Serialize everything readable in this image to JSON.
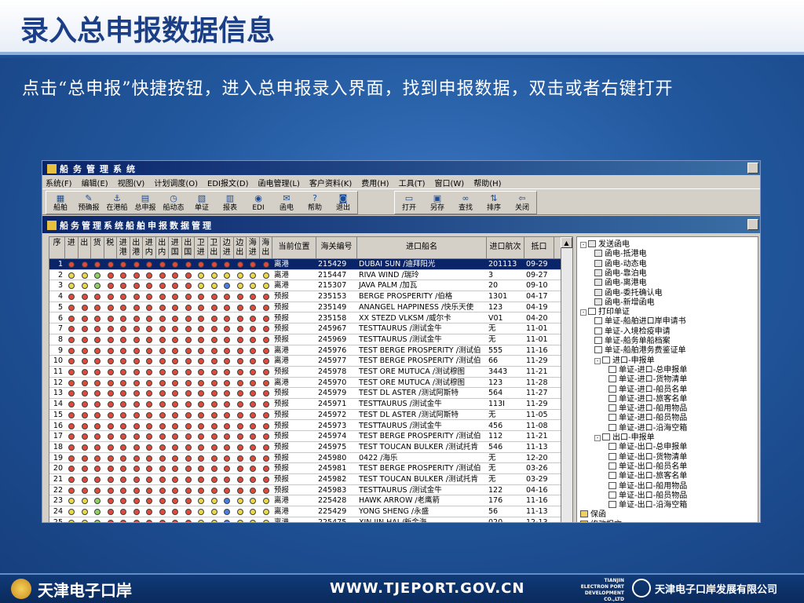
{
  "slide": {
    "title": "录入总申报数据信息",
    "instruction": "点击“总申报”快捷按钮，进入总申报录入界面，找到申报数据，双击或者右键打开"
  },
  "footer": {
    "brand": "天津电子口岸",
    "url": "WWW.TJEPORT.GOV.CN",
    "port_lines": [
      "TIANJIN",
      "ELECTRON PORT",
      "DEVELOPMENT CO.,LTD"
    ],
    "company": "天津电子口岸发展有限公司"
  },
  "app": {
    "title": "船务管理系统",
    "menu": [
      "系统(F)",
      "编辑(E)",
      "视图(V)",
      "计划调度(O)",
      "EDI报文(D)",
      "函电管理(L)",
      "客户资料(K)",
      "费用(H)",
      "工具(T)",
      "窗口(W)",
      "帮助(H)"
    ],
    "toolbar_group1": [
      {
        "label": "船舶",
        "icon": "ship-icon",
        "glyph": "▦"
      },
      {
        "label": "预确报",
        "icon": "report-icon",
        "glyph": "✎"
      },
      {
        "label": "在港船",
        "icon": "port-icon",
        "glyph": "⚓"
      },
      {
        "label": "总申报",
        "icon": "declare-icon",
        "glyph": "▤"
      },
      {
        "label": "船动态",
        "icon": "clock-icon",
        "glyph": "◷"
      },
      {
        "label": "单证",
        "icon": "document-icon",
        "glyph": "▧"
      },
      {
        "label": "报表",
        "icon": "chart-icon",
        "glyph": "▥"
      },
      {
        "label": "EDI",
        "icon": "edi-icon",
        "glyph": "◉"
      },
      {
        "label": "函电",
        "icon": "mail-icon",
        "glyph": "✉"
      },
      {
        "label": "帮助",
        "icon": "help-icon",
        "glyph": "?"
      },
      {
        "label": "退出",
        "icon": "exit-icon",
        "glyph": "◙"
      }
    ],
    "toolbar_group2": [
      {
        "label": "打开",
        "icon": "open-folder-icon",
        "glyph": "▭"
      },
      {
        "label": "另存",
        "icon": "save-icon",
        "glyph": "▣"
      },
      {
        "label": "查找",
        "icon": "binoculars-icon",
        "glyph": "∞"
      },
      {
        "label": "排序",
        "icon": "sort-icon",
        "glyph": "⇅"
      },
      {
        "label": "关闭",
        "icon": "close-icon",
        "glyph": "⇦"
      }
    ],
    "subwindow_title": "船务管理系统船舶申报数据管理",
    "grid": {
      "headers": {
        "index": "序",
        "flags": [
          "进",
          "出",
          "货",
          "税",
          "进港",
          "出港",
          "进内",
          "出内",
          "进国",
          "出国",
          "卫进",
          "卫出",
          "边进",
          "边出",
          "海进",
          "海出"
        ],
        "status": "当前位置",
        "customs_no": "海关编号",
        "ship_name": "进口船名",
        "voyage": "进口航次",
        "arrive": "抵口"
      },
      "dot_colors": {
        "G": "#e8d84a",
        "R": "#e04a3a",
        "N": "#8fd060",
        "B": "#4a7ee0"
      },
      "rows": [
        {
          "n": "1",
          "status": "离港",
          "no": "215429",
          "name": "DUBAI SUN /迪拜阳光",
          "voy": "201113",
          "date": "09-29",
          "flags": "RRRRRRRRRRRRRRRR",
          "selected": true
        },
        {
          "n": "2",
          "status": "离港",
          "no": "215447",
          "name": "RIVA WIND /瑞玲",
          "voy": "3",
          "date": "09-27",
          "flags": "GGNRRRRRRRGGGGGG",
          "selected": false
        },
        {
          "n": "3",
          "status": "离港",
          "no": "215307",
          "name": "JAVA PALM /加瓦",
          "voy": "20",
          "date": "09-10",
          "flags": "GGNRRRRRRRGGBGGG",
          "selected": false
        },
        {
          "n": "4",
          "status": "预报",
          "no": "235153",
          "name": "BERGE PROSPERITY /伯格",
          "voy": "1301",
          "date": "04-17",
          "flags": "RRRRRRRRRRRRRRRR",
          "selected": false
        },
        {
          "n": "5",
          "status": "预报",
          "no": "235149",
          "name": "ANANGEL HAPPINESS /快乐天使",
          "voy": "123",
          "date": "04-19",
          "flags": "RRRRRRRRRRRRRRRR",
          "selected": false
        },
        {
          "n": "6",
          "status": "预报",
          "no": "235158",
          "name": "XX STEZD VLKSM /威尔卡",
          "voy": "V01",
          "date": "04-20",
          "flags": "RRRRRRRRRRRRRRRR",
          "selected": false
        },
        {
          "n": "7",
          "status": "预报",
          "no": "245967",
          "name": "TESTTAURUS /测试金牛",
          "voy": "无",
          "date": "11-01",
          "flags": "RRRRRRRRRRRRRRRR",
          "selected": false
        },
        {
          "n": "8",
          "status": "预报",
          "no": "245969",
          "name": "TESTTAURUS /测试金牛",
          "voy": "无",
          "date": "11-01",
          "flags": "RRRRRRRRRRRRRRRR",
          "selected": false
        },
        {
          "n": "9",
          "status": "离港",
          "no": "245976",
          "name": "TEST BERGE PROSPERITY /测试伯",
          "voy": "555",
          "date": "11-16",
          "flags": "RRRRRRRRRRRRRRRR",
          "selected": false
        },
        {
          "n": "10",
          "status": "离港",
          "no": "245977",
          "name": "TEST BERGE PROSPERITY /测试伯",
          "voy": "66",
          "date": "11-29",
          "flags": "RRRRRRRRRRRRRRRR",
          "selected": false
        },
        {
          "n": "11",
          "status": "预报",
          "no": "245978",
          "name": "TEST ORE MUTUCA /测试穆图",
          "voy": "3443",
          "date": "11-21",
          "flags": "RRRRRRRRRRRRRRRR",
          "selected": false
        },
        {
          "n": "12",
          "status": "离港",
          "no": "245970",
          "name": "TEST ORE MUTUCA /测试穆图",
          "voy": "123",
          "date": "11-28",
          "flags": "RRRRRRRRRRRRRRRR",
          "selected": false
        },
        {
          "n": "13",
          "status": "预报",
          "no": "245979",
          "name": "TEST DL ASTER /测试阿斯特",
          "voy": "564",
          "date": "11-27",
          "flags": "RRRRRRRRRRRRRRRR",
          "selected": false
        },
        {
          "n": "14",
          "status": "预报",
          "no": "245971",
          "name": "TESTTAURUS /测试金牛",
          "voy": "113I",
          "date": "11-29",
          "flags": "RRRRRRRRRRRRRRRR",
          "selected": false
        },
        {
          "n": "15",
          "status": "预报",
          "no": "245972",
          "name": "TEST DL ASTER /测试阿斯特",
          "voy": "无",
          "date": "11-05",
          "flags": "RRRRRRRRRRRRRRRR",
          "selected": false
        },
        {
          "n": "16",
          "status": "预报",
          "no": "245973",
          "name": "TESTTAURUS /测试金牛",
          "voy": "456",
          "date": "11-08",
          "flags": "RRRRRRRRRRRRRRRR",
          "selected": false
        },
        {
          "n": "17",
          "status": "预报",
          "no": "245974",
          "name": "TEST BERGE PROSPERITY /测试伯",
          "voy": "112",
          "date": "11-21",
          "flags": "RRRRRRRRRRRRRRRR",
          "selected": false
        },
        {
          "n": "18",
          "status": "预报",
          "no": "245975",
          "name": "TEST TOUCAN BULKER /测试托肯",
          "voy": "546",
          "date": "11-13",
          "flags": "RRRRRRRRRRRRRRRR",
          "selected": false
        },
        {
          "n": "19",
          "status": "预报",
          "no": "245980",
          "name": "0422 /海乐",
          "voy": "无",
          "date": "12-20",
          "flags": "RRRRRRRRRRRRRRRR",
          "selected": false
        },
        {
          "n": "20",
          "status": "预报",
          "no": "245981",
          "name": "TEST BERGE PROSPERITY /测试伯",
          "voy": "无",
          "date": "03-26",
          "flags": "RRRRRRRRRRRRRRRR",
          "selected": false
        },
        {
          "n": "21",
          "status": "预报",
          "no": "245982",
          "name": "TEST TOUCAN BULKER /测试托肯",
          "voy": "无",
          "date": "03-29",
          "flags": "RRRRRRRRRRRRRRRR",
          "selected": false
        },
        {
          "n": "22",
          "status": "预报",
          "no": "245983",
          "name": "TESTTAURUS /测试金牛",
          "voy": "122",
          "date": "04-16",
          "flags": "RRRRRRRRRRRRRRRR",
          "selected": false
        },
        {
          "n": "23",
          "status": "离港",
          "no": "225428",
          "name": "HAWK ARROW /老鹰箭",
          "voy": "176",
          "date": "11-16",
          "flags": "GGNRRRRRRRGGBGGG",
          "selected": false
        },
        {
          "n": "24",
          "status": "离港",
          "no": "225429",
          "name": "YONG SHENG /永盛",
          "voy": "56",
          "date": "11-13",
          "flags": "GGNRRRRRRRGGBGGG",
          "selected": false
        },
        {
          "n": "25",
          "status": "离港",
          "no": "225475",
          "name": "XIN JIN HAI /新金海",
          "voy": "020",
          "date": "12-13",
          "flags": "GGNRRRRRRRGGBGGG",
          "selected": false
        }
      ]
    },
    "tree": [
      {
        "label": "发送函电",
        "level": 0,
        "kind": "env",
        "exp": "-"
      },
      {
        "label": "函电-抵港电",
        "level": 1,
        "kind": "env"
      },
      {
        "label": "函电-动态电",
        "level": 1,
        "kind": "env"
      },
      {
        "label": "函电-靠泊电",
        "level": 1,
        "kind": "env"
      },
      {
        "label": "函电-离港电",
        "level": 1,
        "kind": "env"
      },
      {
        "label": "函电-委托确认电",
        "level": 1,
        "kind": "env"
      },
      {
        "label": "函电-新增函电",
        "level": 1,
        "kind": "env"
      },
      {
        "label": "打印单证",
        "level": 0,
        "kind": "doc",
        "exp": "-"
      },
      {
        "label": "单证-船舶进口岸申请书",
        "level": 1,
        "kind": "doc"
      },
      {
        "label": "单证-入境检疫申请",
        "level": 1,
        "kind": "doc"
      },
      {
        "label": "单证-船务单船档案",
        "level": 1,
        "kind": "doc"
      },
      {
        "label": "单证-船舶港务费鉴证单",
        "level": 1,
        "kind": "doc"
      },
      {
        "label": "进口-申报单",
        "level": 1,
        "kind": "doc",
        "exp": "-"
      },
      {
        "label": "单证-进口-总申报单",
        "level": 2,
        "kind": "doc"
      },
      {
        "label": "单证-进口-货物清单",
        "level": 2,
        "kind": "doc"
      },
      {
        "label": "单证-进口-船员名单",
        "level": 2,
        "kind": "doc"
      },
      {
        "label": "单证-进口-旅客名单",
        "level": 2,
        "kind": "doc"
      },
      {
        "label": "单证-进口-船用物品",
        "level": 2,
        "kind": "doc"
      },
      {
        "label": "单证-进口-船员物品",
        "level": 2,
        "kind": "doc"
      },
      {
        "label": "单证-进口-沿海空箱",
        "level": 2,
        "kind": "doc"
      },
      {
        "label": "出口-申报单",
        "level": 1,
        "kind": "doc",
        "exp": "-"
      },
      {
        "label": "单证-出口-总申报单",
        "level": 2,
        "kind": "doc"
      },
      {
        "label": "单证-出口-货物清单",
        "level": 2,
        "kind": "doc"
      },
      {
        "label": "单证-出口-船员名单",
        "level": 2,
        "kind": "doc"
      },
      {
        "label": "单证-出口-旅客名单",
        "level": 2,
        "kind": "doc"
      },
      {
        "label": "单证-出口-船用物品",
        "level": 2,
        "kind": "doc"
      },
      {
        "label": "单证-出口-船员物品",
        "level": 2,
        "kind": "doc"
      },
      {
        "label": "单证-出口-沿海空箱",
        "level": 2,
        "kind": "doc"
      },
      {
        "label": "保函",
        "level": 0,
        "kind": "fld"
      },
      {
        "label": "修改报文",
        "level": 0,
        "kind": "fld"
      }
    ]
  }
}
